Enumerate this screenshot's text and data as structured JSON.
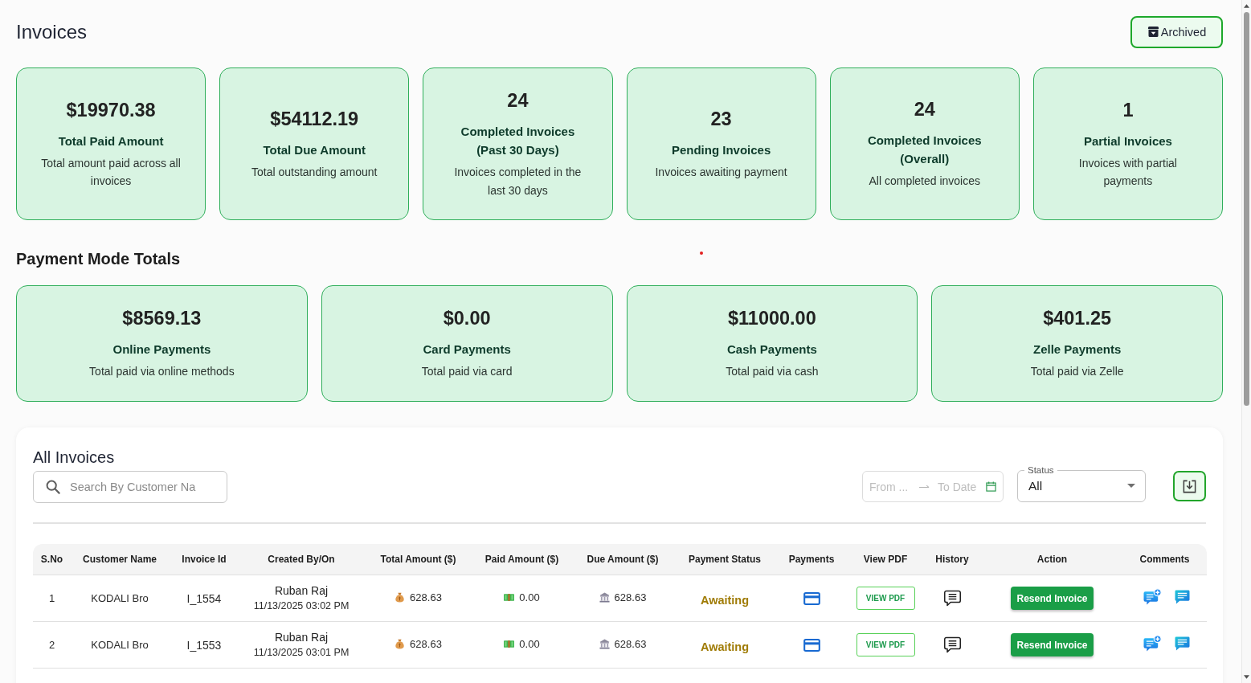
{
  "header": {
    "title": "Invoices",
    "archived_button": "Archived"
  },
  "summary_cards": [
    {
      "value": "$19970.38",
      "title": "Total Paid Amount",
      "description": "Total amount paid across all invoices"
    },
    {
      "value": "$54112.19",
      "title": "Total Due Amount",
      "description": "Total outstanding amount"
    },
    {
      "value": "24",
      "title": "Completed Invoices (Past 30 Days)",
      "description": "Invoices completed in the last 30 days"
    },
    {
      "value": "23",
      "title": "Pending Invoices",
      "description": "Invoices awaiting payment"
    },
    {
      "value": "24",
      "title": "Completed Invoices (Overall)",
      "description": "All completed invoices"
    },
    {
      "value": "1",
      "title": "Partial Invoices",
      "description": "Invoices with partial payments"
    }
  ],
  "payment_modes": {
    "heading": "Payment Mode Totals",
    "cards": [
      {
        "value": "$8569.13",
        "title": "Online Payments",
        "description": "Total paid via online methods"
      },
      {
        "value": "$0.00",
        "title": "Card Payments",
        "description": "Total paid via card"
      },
      {
        "value": "$11000.00",
        "title": "Cash Payments",
        "description": "Total paid via cash"
      },
      {
        "value": "$401.25",
        "title": "Zelle Payments",
        "description": "Total paid via Zelle"
      }
    ]
  },
  "invoices": {
    "heading": "All Invoices",
    "search": {
      "placeholder": "Search By Customer Na"
    },
    "date_range": {
      "from_placeholder": "From ...",
      "to_placeholder": "To Date"
    },
    "status_filter": {
      "label": "Status",
      "value": "All"
    },
    "table": {
      "columns": [
        "S.No",
        "Customer Name",
        "Invoice Id",
        "Created By/On",
        "Total Amount ($)",
        "Paid Amount ($)",
        "Due Amount ($)",
        "Payment Status",
        "Payments",
        "View PDF",
        "History",
        "Action",
        "Comments"
      ],
      "rows": [
        {
          "s_no": "1",
          "customer_name": "KODALI Bro",
          "invoice_id": "I_1554",
          "created_by": "Ruban Raj",
          "created_on": "11/13/2025 03:02 PM",
          "total_amount": "628.63",
          "paid_amount": "0.00",
          "due_amount": "628.63",
          "payment_status": "Awaiting",
          "view_pdf": "VIEW PDF",
          "action": "Resend Invoice"
        },
        {
          "s_no": "2",
          "customer_name": "KODALI Bro",
          "invoice_id": "I_1553",
          "created_by": "Ruban Raj",
          "created_on": "11/13/2025 03:01 PM",
          "total_amount": "628.63",
          "paid_amount": "0.00",
          "due_amount": "628.63",
          "payment_status": "Awaiting",
          "view_pdf": "VIEW PDF",
          "action": "Resend Invoice"
        }
      ]
    }
  }
}
